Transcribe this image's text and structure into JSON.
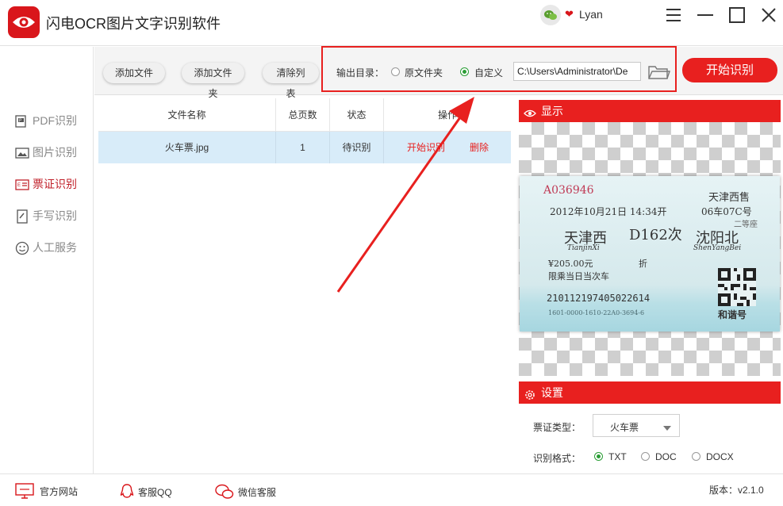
{
  "app": {
    "title": "闪电OCR图片文字识别软件",
    "username": "Lyan"
  },
  "toolbar": {
    "add_file": "添加文件",
    "add_folder": "添加文件夹",
    "clear_list": "清除列表",
    "output_label": "输出目录：",
    "option_original": "原文件夹",
    "option_custom": "自定义",
    "output_path": "C:\\Users\\Administrator\\De",
    "start_button": "开始识别"
  },
  "sidebar": {
    "items": [
      {
        "label": "PDF识别",
        "icon": "pdf-icon"
      },
      {
        "label": "图片识别",
        "icon": "image-icon"
      },
      {
        "label": "票证识别",
        "icon": "ticket-icon"
      },
      {
        "label": "手写识别",
        "icon": "handwriting-icon"
      },
      {
        "label": "人工服务",
        "icon": "smiley-icon"
      }
    ],
    "active": 2
  },
  "table": {
    "headers": [
      "文件名称",
      "总页数",
      "状态",
      "操作"
    ],
    "rows": [
      {
        "name": "火车票.jpg",
        "pages": "1",
        "status": "待识别",
        "action_start": "开始识别",
        "action_delete": "删除"
      }
    ]
  },
  "preview": {
    "title": "显示",
    "ticket": {
      "serial": "A036946",
      "station_sale": "天津西售",
      "datetime": "2012年10月21日 14:34开",
      "car_seat": "06车07C号",
      "seat_class": "二等座",
      "from": "天津西",
      "from_pinyin": "TianjinXi",
      "train": "D162次",
      "to": "沈阳北",
      "to_pinyin": "ShenYangBei",
      "price": "¥205.00元",
      "discount": "折",
      "note": "限乘当日当次车",
      "id_number": "210112197405022614",
      "bottom_code": "1601-0000-1610-22A0-3694-6",
      "brand": "和谐号"
    }
  },
  "settings": {
    "title": "设置",
    "type_label": "票证类型：",
    "type_value": "火车票",
    "format_label": "识别格式：",
    "formats": [
      "TXT",
      "DOC",
      "DOCX"
    ],
    "selected_format": "TXT"
  },
  "footer": {
    "website": "官方网站",
    "qq": "客服QQ",
    "wechat": "微信客服",
    "version": "版本：v2.1.0"
  },
  "colors": {
    "accent": "#e8201f",
    "selected_row": "#d8ecf9",
    "radio_on": "#2a9d35"
  }
}
